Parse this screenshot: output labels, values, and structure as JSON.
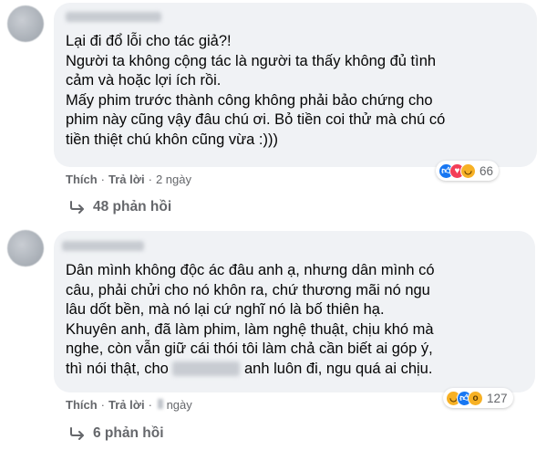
{
  "comments": [
    {
      "text": "Lại đi đổ lỗi cho tác giả?!\nNgười ta không cộng tác là người ta thấy không đủ tình\ncảm và hoặc lợi ích rồi.\nMấy phim trước thành công không phải bảo chứng cho\nphim này cũng vậy đâu chú ơi. Bỏ tiền coi thử mà chú có\ntiền thiệt chú khôn cũng vừa :)))",
      "like_label": "Thích",
      "reply_label": "Trả lời",
      "sep": "·",
      "time": "2 ngày",
      "reaction_count": "66",
      "reaction_icons": [
        "like-icon",
        "love-icon",
        "haha-icon"
      ],
      "replies_label": "48 phản hồi"
    },
    {
      "text_before": "Dân mình không độc ác đâu anh ạ, nhưng dân mình có\ncâu, phải chửi cho nó khôn ra, chứ thương mãi nó ngu\nlâu dốt bền, mà nó lại cứ nghĩ nó là bố thiên hạ.\nKhuyên anh, đã làm phim, làm nghệ thuật, chịu khó mà\nnghe, còn vẫn giữ cái thói tôi làm chả cần biết ai góp ý,\nthì nói thật, cho ",
      "text_after": " anh luôn đi, ngu quá ai chịu.",
      "like_label": "Thích",
      "reply_label": "Trả lời",
      "sep": "·",
      "time": "ngày",
      "reaction_count": "127",
      "reaction_icons": [
        "haha-icon",
        "like-icon",
        "wow-icon"
      ],
      "replies_label": "6 phản hồi"
    }
  ],
  "colors": {
    "bubble": "#f0f2f5",
    "muted": "#65676b",
    "like": "#1877f2",
    "love": "#f33e58",
    "haha": "#f7b125"
  }
}
